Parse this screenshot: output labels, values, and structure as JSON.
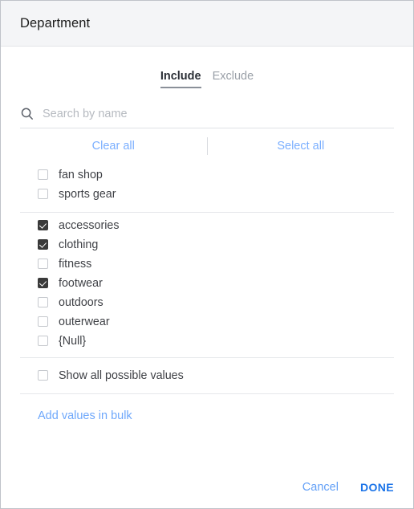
{
  "dialog": {
    "title": "Department"
  },
  "tabs": [
    {
      "label": "Include",
      "active": true
    },
    {
      "label": "Exclude",
      "active": false
    }
  ],
  "search": {
    "icon": "search-icon",
    "placeholder": "Search by name",
    "value": ""
  },
  "bulk_actions": {
    "clear_all": "Clear all",
    "select_all": "Select all"
  },
  "selected_section": [
    {
      "label": "fan shop",
      "checked": false
    },
    {
      "label": "sports gear",
      "checked": false
    }
  ],
  "values_section": [
    {
      "label": "accessories",
      "checked": true
    },
    {
      "label": "clothing",
      "checked": true
    },
    {
      "label": "fitness",
      "checked": false
    },
    {
      "label": "footwear",
      "checked": true
    },
    {
      "label": "outdoors",
      "checked": false
    },
    {
      "label": "outerwear",
      "checked": false
    },
    {
      "label": "{Null}",
      "checked": false
    }
  ],
  "show_all": {
    "label": "Show all possible values",
    "checked": false
  },
  "add_bulk": {
    "label": "Add values in bulk"
  },
  "footer": {
    "cancel": "Cancel",
    "done": "DONE"
  },
  "colors": {
    "link_blue": "#6fa8fb",
    "done_blue": "#1a73e8",
    "checkbox_fill": "#3a3a3a",
    "header_bg": "#f4f5f7",
    "text": "#3f4146"
  }
}
